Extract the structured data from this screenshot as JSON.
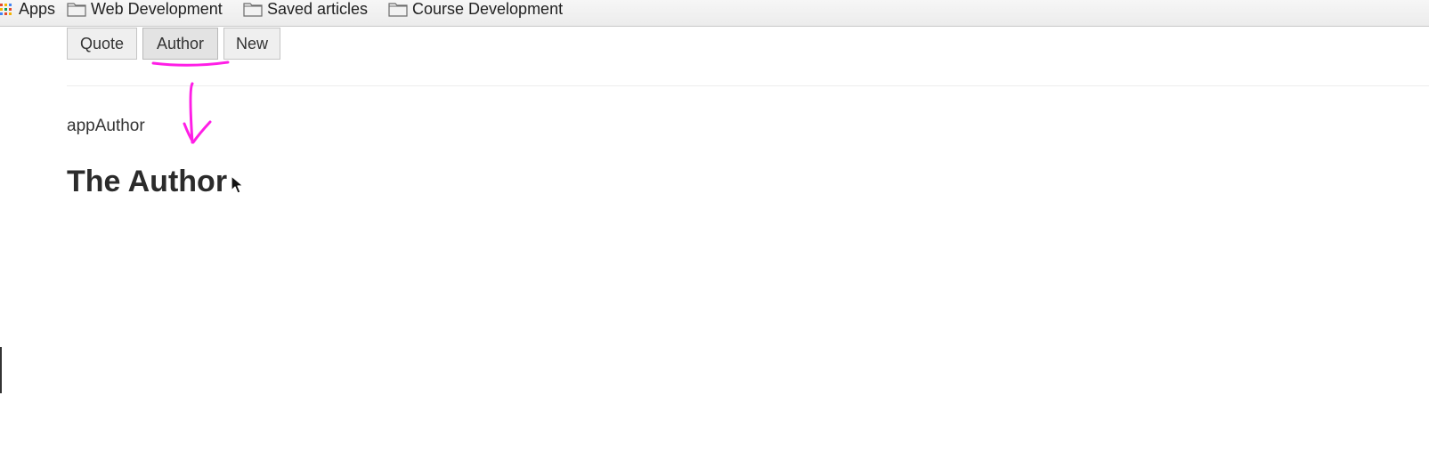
{
  "bookmarks": {
    "apps_label": "Apps",
    "items": [
      {
        "label": "Web Development",
        "icon": "folder-icon"
      },
      {
        "label": "Saved articles",
        "icon": "folder-icon"
      },
      {
        "label": "Course Development",
        "icon": "folder-icon"
      }
    ]
  },
  "nav": {
    "buttons": [
      {
        "label": "Quote"
      },
      {
        "label": "Author",
        "active": true
      },
      {
        "label": "New"
      }
    ]
  },
  "content": {
    "component_label": "appAuthor",
    "heading": "The Author"
  },
  "annotation": {
    "color": "#ff1ee6",
    "icon": "arrow-down-icon"
  },
  "colors": {
    "annotation": "#ff1ee6",
    "text": "#333333",
    "button_bg": "#efefef"
  }
}
